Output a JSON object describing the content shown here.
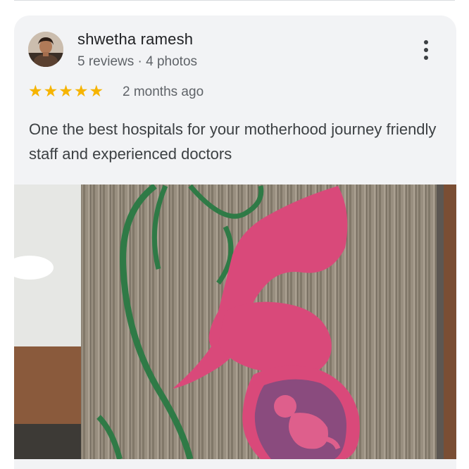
{
  "review": {
    "author": "shwetha ramesh",
    "author_meta": "5 reviews · 4 photos",
    "rating": 5,
    "time_ago": "2 months ago",
    "text": "One the best hospitals for your motherhood journey friendly staff and experienced doctors",
    "photo": {
      "description_icon": "review-photo"
    }
  },
  "icons": {
    "more": "more-vert-icon",
    "star": "star-icon"
  },
  "colors": {
    "star": "#f6b400",
    "card_bg": "#f2f3f5",
    "name": "#202124",
    "meta": "#5f6368",
    "body_text": "#3c4043"
  }
}
